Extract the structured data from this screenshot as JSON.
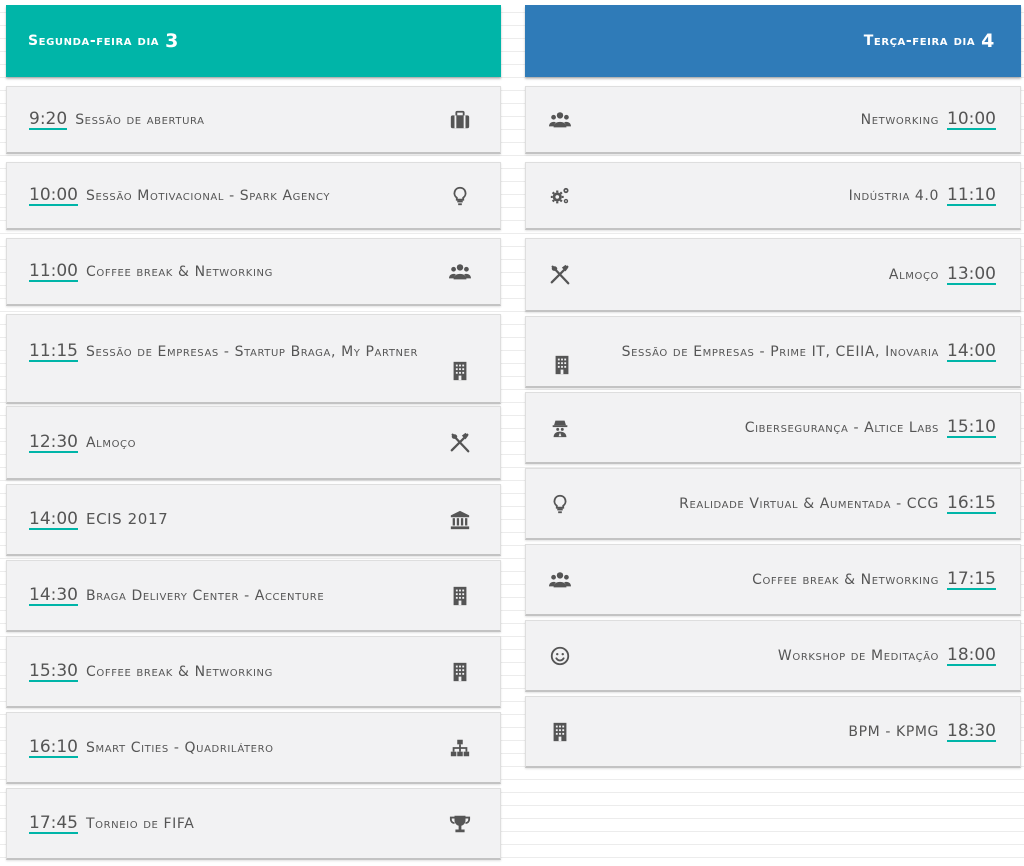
{
  "day3": {
    "label": "Segunda-feira dia",
    "number": "3",
    "color": "#00b5a8",
    "sessions": [
      {
        "time": "9:20",
        "title": "Sessão de abertura",
        "icon": "briefcase-icon"
      },
      {
        "time": "10:00",
        "title": "Sessão Motivacional - Spark Agency",
        "icon": "lightbulb-icon"
      },
      {
        "time": "11:00",
        "title": "Coffee break & Networking",
        "icon": "users-icon"
      },
      {
        "time": "11:15",
        "title": "Sessão de Empresas - Startup Braga, My Partner",
        "icon": "building-icon"
      },
      {
        "time": "12:30",
        "title": "Almoço",
        "icon": "utensils-icon"
      },
      {
        "time": "14:00",
        "title": "ECIS 2017",
        "icon": "bank-icon"
      },
      {
        "time": "14:30",
        "title": "Braga Delivery Center - Accenture",
        "icon": "building-icon"
      },
      {
        "time": "15:30",
        "title": "Coffee break & Networking",
        "icon": "building-icon"
      },
      {
        "time": "16:10",
        "title": "Smart Cities - Quadrilátero",
        "icon": "sitemap-icon"
      },
      {
        "time": "17:45",
        "title": "Torneio de FIFA",
        "icon": "trophy-icon"
      }
    ]
  },
  "day4": {
    "label": "Terça-feira dia",
    "number": "4",
    "color": "#2f7bb8",
    "sessions": [
      {
        "time": "10:00",
        "title": "Networking",
        "icon": "users-icon"
      },
      {
        "time": "11:10",
        "title": "Indústria 4.0",
        "icon": "cogs-icon"
      },
      {
        "time": "13:00",
        "title": "Almoço",
        "icon": "utensils-icon"
      },
      {
        "time": "14:00",
        "title": "Sessão de Empresas - Prime IT, CEIIA, Inovaria",
        "icon": "building-icon"
      },
      {
        "time": "15:10",
        "title": "Cibersegurança - Altice Labs",
        "icon": "user-secret-icon"
      },
      {
        "time": "16:15",
        "title": "Realidade Virtual & Aumentada - CCG",
        "icon": "lightbulb-icon"
      },
      {
        "time": "17:15",
        "title": "Coffee break & Networking",
        "icon": "users-icon"
      },
      {
        "time": "18:00",
        "title": "Workshop de Meditação",
        "icon": "smile-icon"
      },
      {
        "time": "18:30",
        "title": "BPM - KPMG",
        "icon": "building-icon"
      }
    ]
  }
}
